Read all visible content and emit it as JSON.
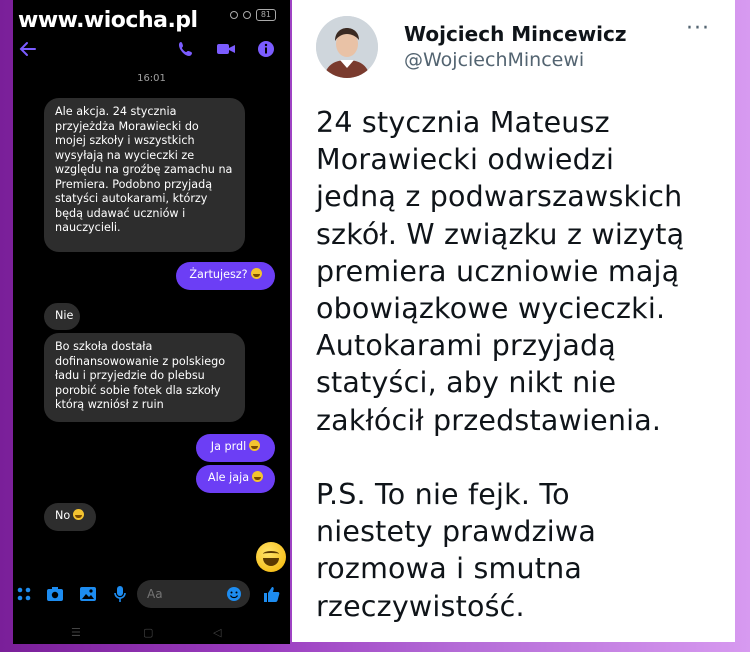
{
  "watermark": "www.wiocha.pl",
  "status_bar": {
    "battery": "81"
  },
  "conversation": {
    "timestamp": "16:01",
    "messages": [
      {
        "from": "them",
        "text": "Ale akcja. 24 stycznia\nprzyjeżdża Morawiecki do\nmojej szkoły i wszystkich\nwysyłają na wycieczki ze\nwzględu na groźbę zamachu na\nPremiera. Podobno przyjadą\nstatyści autokarami, którzy\nbędą udawać uczniów i\nnauczycieli."
      },
      {
        "from": "me",
        "text": "Żartujesz?"
      },
      {
        "from": "them",
        "text": "Nie"
      },
      {
        "from": "them",
        "text": "Bo szkoła dostała\ndofinansowowanie z polskiego\nładu i przyjedzie do plebsu\nporobić sobie fotek dla szkoły\nktórą wzniósł z ruin"
      },
      {
        "from": "me",
        "text": "Ja prdl"
      },
      {
        "from": "me",
        "text": "Ale jaja"
      },
      {
        "from": "them",
        "text": "No"
      }
    ]
  },
  "composer": {
    "placeholder": "Aa"
  },
  "tweet": {
    "name": "Wojciech Mincewicz",
    "handle": "@WojciechMincewi",
    "more": "···",
    "body": "24 stycznia Mateusz\nMorawiecki odwiedzi\njedną z podwarszawskich\nszkół. W związku z wizytą\npremiera uczniowie mają\nobowiązkowe wycieczki.\nAutokarami przyjadą\nstatyści, aby nikt nie\nzakłócił przedstawienia.\n\nP.S. To nie fejk. To\nniestety prawdziwa\nrozmowa i smutna\nrzeczywistość."
  },
  "colors": {
    "messenger_purple": "#6c3ef5",
    "incoming_bubble": "#2d2d2d",
    "accent_blue": "#1d8cf0"
  },
  "icons": [
    "back-arrow-icon",
    "phone-icon",
    "video-icon",
    "info-icon",
    "menu-icon",
    "camera-icon",
    "gallery-icon",
    "mic-icon",
    "emoji-icon",
    "thumbs-up-icon"
  ]
}
